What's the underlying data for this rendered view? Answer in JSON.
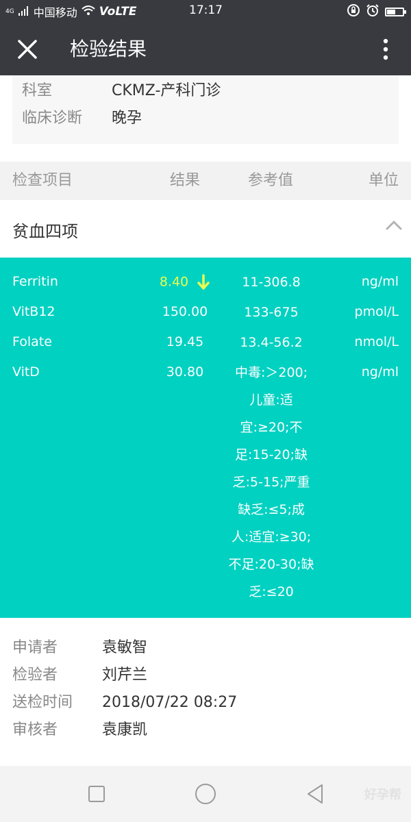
{
  "status_bar": {
    "network_tag": "4G",
    "carrier": "中国移动",
    "volte": "VoLTE",
    "time": "17:17"
  },
  "header": {
    "title": "检验结果"
  },
  "info": {
    "department_label": "科室",
    "department_value": "CKMZ-产科门诊",
    "diagnosis_label": "临床诊断",
    "diagnosis_value": "晚孕"
  },
  "table_header": {
    "item": "检查项目",
    "result": "结果",
    "reference": "参考值",
    "unit": "单位"
  },
  "section": {
    "name": "贫血四项"
  },
  "results": [
    {
      "item": "Ferritin",
      "value": "8.40",
      "flag": "low",
      "reference": "11-306.8",
      "unit": "ng/ml"
    },
    {
      "item": "VitB12",
      "value": "150.00",
      "reference": "133-675",
      "unit": "pmol/L"
    },
    {
      "item": "Folate",
      "value": "19.45",
      "reference": "13.4-56.2",
      "unit": "nmol/L"
    },
    {
      "item": "VitD",
      "value": "30.80",
      "reference_lines": [
        "中毒:＞200;",
        "儿童:适",
        "宜:≥20;不",
        "足:15-20;缺",
        "乏:5-15;严重",
        "缺乏:≤5;成",
        "人:适宜:≥30;",
        "不足:20-30;缺",
        "乏:≤20"
      ],
      "unit": "ng/ml"
    }
  ],
  "footer": {
    "requester_label": "申请者",
    "requester_value": "袁敏智",
    "inspector_label": "检验者",
    "inspector_value": "刘芹兰",
    "time_label": "送检时间",
    "time_value": "2018/07/22 08:27",
    "reviewer_label": "审核者",
    "reviewer_value": "袁康凯"
  },
  "watermark": "好孕帮",
  "colors": {
    "header_bg": "#393a3f",
    "results_bg": "#00d1c1",
    "low_flag": "#e9ff52"
  }
}
